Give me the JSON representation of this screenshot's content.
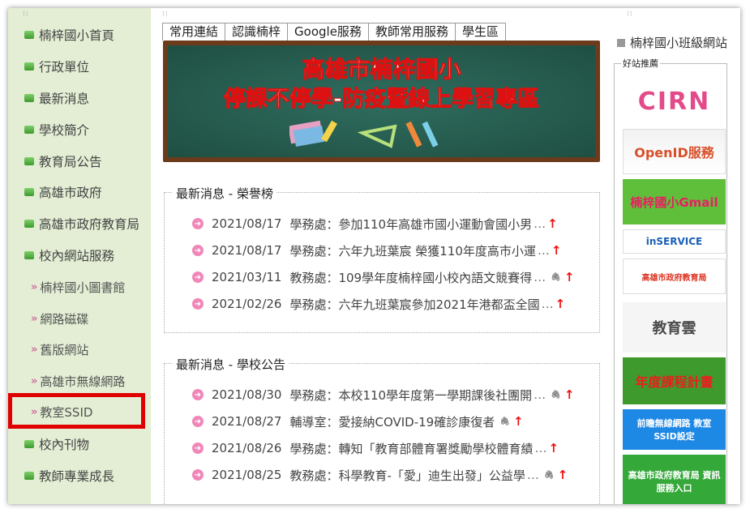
{
  "nav": {
    "items": [
      "楠梓國小首頁",
      "行政單位",
      "最新消息",
      "學校簡介",
      "教育局公告",
      "高雄市政府",
      "高雄市政府教育局",
      "校內網站服務"
    ],
    "sub_items": [
      "楠梓國小圖書館",
      "網路磁碟",
      "舊版網站",
      "高雄市無線網路",
      "教室SSID"
    ],
    "items_after": [
      "校內刊物",
      "教師專業成長"
    ]
  },
  "tabs": [
    "常用連結",
    "認識楠梓",
    "Google服務",
    "教師常用服務",
    "學生區"
  ],
  "banner": {
    "line1": "高雄市楠梓國小",
    "line2": "停課不停學-防疫暨線上學習專區"
  },
  "honor": {
    "title": "最新消息 - 榮譽榜",
    "rows": [
      {
        "date": "2021/08/17",
        "text": "學務處：參加110年高雄市國小運動會國小男",
        "clip": false
      },
      {
        "date": "2021/08/17",
        "text": "學務處：六年九班葉宸 榮獲110年度高市小運",
        "clip": false
      },
      {
        "date": "2021/03/11",
        "text": "教務處：109學年度楠梓國小校內語文競賽得",
        "clip": true
      },
      {
        "date": "2021/02/26",
        "text": "學務處：六年九班葉宸參加2021年港都盃全國",
        "clip": false
      }
    ]
  },
  "announce": {
    "title": "最新消息 - 學校公告",
    "rows": [
      {
        "date": "2021/08/30",
        "text": "學務處：本校110學年度第一學期課後社團開",
        "clip": true
      },
      {
        "date": "2021/08/27",
        "text": "輔導室：愛接納COVID-19確診康復者",
        "clip": true
      },
      {
        "date": "2021/08/26",
        "text": "學務處：轉知「教育部體育署獎勵學校體育績",
        "clip": false
      },
      {
        "date": "2021/08/25",
        "text": "教務處：科學教育-「愛」迪生出發」公益學",
        "clip": true
      }
    ]
  },
  "right": {
    "link": "楠梓國小班級網站",
    "good_sites_title": "好站推薦",
    "logos": [
      "CIRN",
      "OpenID服務",
      "楠梓國小Gmail",
      "inSERVICE",
      "高雄市政府教育局",
      "教育雲",
      "年度課程計畫",
      "前瞻無線網路 教室SSID設定",
      "高雄市政府教育局 資訊服務入口"
    ]
  },
  "colors": {
    "accent": "#e00000",
    "nav_bg": "#e3eed4",
    "bullet": "#4caf3a",
    "news_dot": "#f087b8",
    "arrow": "#e11111"
  }
}
